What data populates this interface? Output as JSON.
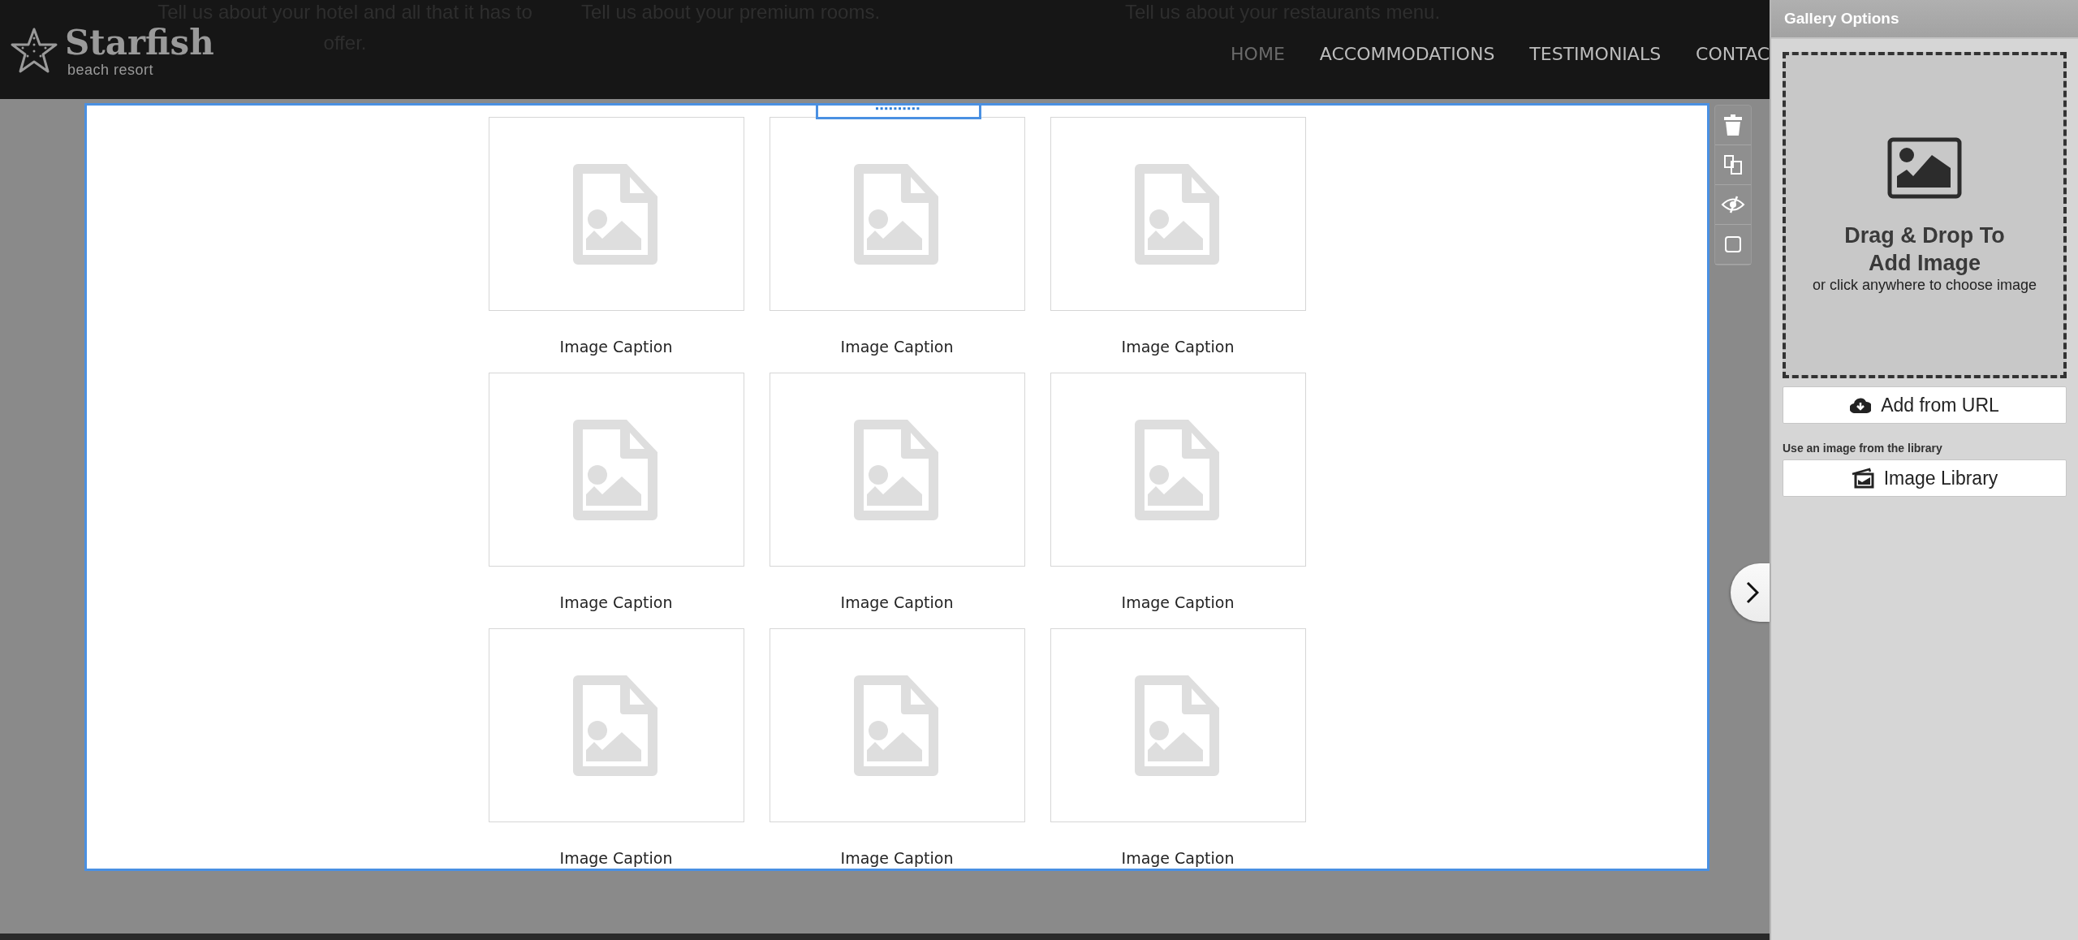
{
  "header": {
    "background_texts": [
      {
        "lines": [
          "Tell us about your hotel and all that it has to",
          "offer."
        ]
      },
      {
        "lines": [
          "Tell us about your premium rooms."
        ]
      },
      {
        "lines": [
          "Tell us about your restaurants menu."
        ]
      }
    ],
    "logo": {
      "name": "Starfish",
      "tagline": "beach resort"
    },
    "nav": [
      {
        "label": "HOME",
        "selected": true
      },
      {
        "label": "ACCOMMODATIONS",
        "selected": false
      },
      {
        "label": "TESTIMONIALS",
        "selected": false
      },
      {
        "label": "CONTAC",
        "selected": false
      }
    ]
  },
  "gallery": {
    "items": [
      {
        "caption": "Image Caption"
      },
      {
        "caption": "Image Caption"
      },
      {
        "caption": "Image Caption"
      },
      {
        "caption": "Image Caption"
      },
      {
        "caption": "Image Caption"
      },
      {
        "caption": "Image Caption"
      },
      {
        "caption": "Image Caption"
      },
      {
        "caption": "Image Caption"
      },
      {
        "caption": "Image Caption"
      }
    ]
  },
  "panel": {
    "title": "Gallery Options",
    "dropzone": {
      "title": "Drag & Drop To Add Image",
      "hint": "or click anywhere to choose image"
    },
    "url_button": "Add from URL",
    "library_label": "Use an image from the library",
    "library_button": "Image Library"
  }
}
